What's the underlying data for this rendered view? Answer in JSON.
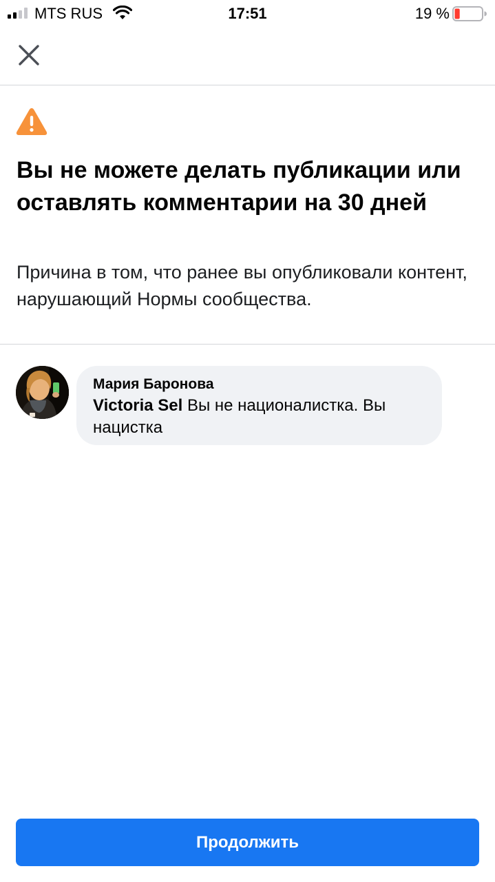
{
  "status_bar": {
    "carrier": "MTS RUS",
    "time": "17:51",
    "battery_percent": "19 %",
    "battery_level": 0.19,
    "battery_color": "#ff3b30",
    "signal_bars_filled": 2,
    "icons": [
      "signal-icon",
      "wifi-icon",
      "battery-icon"
    ]
  },
  "header": {
    "close_icon": "close-icon"
  },
  "warning": {
    "icon": "warning-triangle-icon",
    "icon_color": "#f7923a",
    "headline": "Вы не можете делать публикации или оставлять комментарии на 30 дней",
    "reason": "Причина в том, что ранее вы опубликовали контент, нарушающий Нормы сообщества."
  },
  "comment": {
    "author": "Мария Баронова",
    "mention": "Victoria Sel",
    "text": "Вы не националистка. Вы нацистка"
  },
  "continue_button": {
    "label": "Продолжить",
    "color": "#1877f2"
  }
}
